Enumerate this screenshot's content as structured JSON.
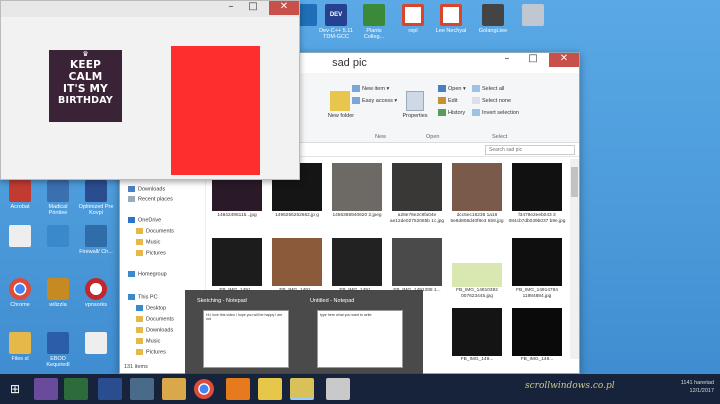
{
  "desktop_top_icons": [
    {
      "label": "",
      "color": "#1f6fb8"
    },
    {
      "label": "Dev-C++ 5.11 TDM-GCC",
      "color": "#26418f"
    },
    {
      "label": "Plants Colleg...",
      "color": "#3a8a3a"
    },
    {
      "label": "repl",
      "color": "#d9452b"
    },
    {
      "label": "Lee Nechyal",
      "color": "#d9452b"
    },
    {
      "label": "GolangLtee",
      "color": "#444444"
    },
    {
      "label": "",
      "color": "#bfc8d2"
    }
  ],
  "desktop_left_icons": [
    {
      "label": "Acrobat",
      "color": "#c23b32"
    },
    {
      "label": "Madical Printiee",
      "color": "#3a6fb0"
    },
    {
      "label": "Optimized Pre Kovpl",
      "color": "#2a4d8f"
    },
    {
      "label": "",
      "color": "#eeeeee"
    },
    {
      "label": "",
      "color": "#3a8acb"
    },
    {
      "label": "Firewall/ Ch...",
      "color": "#2f6ca8"
    },
    {
      "label": "Chrome",
      "color": "#dd4b39"
    },
    {
      "label": "wilizzla",
      "color": "#c58a22"
    },
    {
      "label": "vpnsorks",
      "color": "#c0282d"
    },
    {
      "label": "Files sl",
      "color": "#e6b84a"
    },
    {
      "label": "EBOD Kequiredl",
      "color": "#2b5ea8"
    },
    {
      "label": "",
      "color": "#eeeeee"
    }
  ],
  "top_window": {
    "poster_lines": [
      "KEEP",
      "CALM",
      "IT'S MY",
      "BIRTHDAY"
    ],
    "min_icon": "minimize-icon",
    "max_icon": "maximize-icon",
    "close_glyph": "✕"
  },
  "explorer": {
    "title": "sad pic",
    "close_glyph": "✕",
    "ribbon": {
      "new_item": "New item",
      "easy_access": "Easy access",
      "new_folder": "New folder",
      "new_group": "New",
      "open": "Open",
      "edit": "Edit",
      "history": "History",
      "properties": "Properties",
      "open_group": "Open",
      "select_all": "Select all",
      "select_none": "Select none",
      "invert_selection": "Invert selection",
      "select_group": "Select"
    },
    "search_placeholder": "Search sad pic",
    "nav": {
      "downloads": "Downloads",
      "recent_places": "Recent places",
      "onedrive": "OneDrive",
      "documents": "Documents",
      "music": "Music",
      "pictures": "Pictures",
      "homegroup": "Homegroup",
      "this_pc": "This PC",
      "desktop": "Desktop",
      "documents2": "Documents",
      "downloads2": "Downloads",
      "music2": "Music",
      "pictures2": "Pictures"
    },
    "row1_captions": [
      "14842495115...jpg",
      "1496256252662.jp g",
      "1456368940620 2.jpeg",
      "a28e76e2c9fa04e ae12de02752085b 1c.jpg",
      "dcc5ec16238 1a16 5e8d808d40f8e3 5b9.jpg",
      "f3478e2eeb043 3 084cb7db039b037 b9e.jpg"
    ],
    "row2_captions": [
      "FB_IMG_1491...",
      "FB_IMG_1491...",
      "FB_IMG_1491...",
      "FB_IMG_1491285 1...",
      "FB_IMG_14810392 007623445.jpg",
      "FB_IMG_14914784 11984884.jpg"
    ],
    "row3_captions": [
      "",
      "",
      "",
      "",
      "FB_IMG_149...",
      "FB_IMG_149..."
    ],
    "status": "131 items"
  },
  "preview": {
    "left_title": "Sketching - Notepad",
    "right_title": "Untitled - Notepad",
    "left_text": "Hi i love this video i hope you will be happy i am not",
    "right_text": "type here what you want to write"
  },
  "taskbar": {
    "tray_time": "1141 hanetad",
    "tray_date": "12/1/2017"
  },
  "watermark": "scrollwindows.co.pl"
}
